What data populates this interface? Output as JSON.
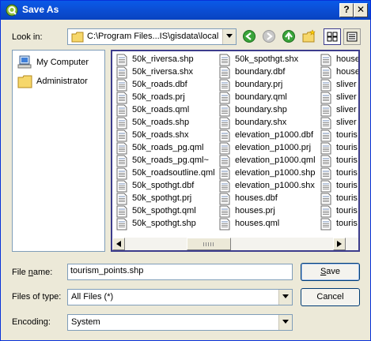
{
  "window": {
    "title": "Save As",
    "help_label": "?",
    "close_label": "✕"
  },
  "look_in": {
    "label": "Look in:",
    "path": "C:\\Program Files...IS\\gisdata\\local"
  },
  "sidebar": {
    "items": [
      {
        "label": "My Computer",
        "icon": "computer-icon"
      },
      {
        "label": "Administrator",
        "icon": "folder-icon"
      }
    ]
  },
  "files": {
    "columns": [
      [
        "50k_riversa.shp",
        "50k_riversa.shx",
        "50k_roads.dbf",
        "50k_roads.prj",
        "50k_roads.qml",
        "50k_roads.shp",
        "50k_roads.shx",
        "50k_roads_pg.qml",
        "50k_roads_pg.qml~",
        "50k_roadsoutline.qml",
        "50k_spothgt.dbf",
        "50k_spothgt.prj",
        "50k_spothgt.qml",
        "50k_spothgt.shp"
      ],
      [
        "50k_spothgt.shx",
        "boundary.dbf",
        "boundary.prj",
        "boundary.qml",
        "boundary.shp",
        "boundary.shx",
        "elevation_p1000.dbf",
        "elevation_p1000.prj",
        "elevation_p1000.qml",
        "elevation_p1000.shp",
        "elevation_p1000.shx",
        "houses.dbf",
        "houses.prj",
        "houses.qml"
      ],
      [
        "house",
        "house",
        "sliver",
        "sliver",
        "sliver",
        "sliver",
        "touris",
        "touris",
        "touris",
        "touris",
        "touris",
        "touris",
        "touris",
        "touris"
      ]
    ]
  },
  "file_name": {
    "label_prefix": "File ",
    "label_underlined": "n",
    "label_suffix": "ame:",
    "value": "tourism_points.shp"
  },
  "file_type": {
    "label": "Files of type:",
    "value": "All Files (*)"
  },
  "encoding": {
    "label": "Encoding:",
    "value": "System"
  },
  "buttons": {
    "save_underlined": "S",
    "save_rest": "ave",
    "cancel": "Cancel"
  }
}
